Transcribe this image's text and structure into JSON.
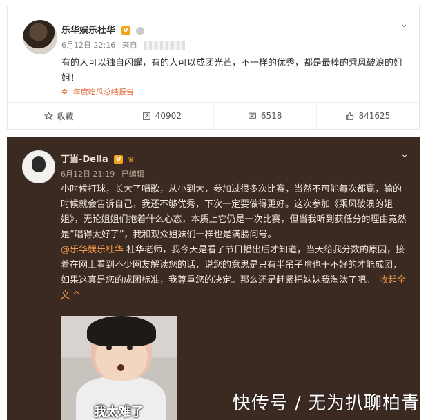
{
  "post1": {
    "author": "乐华娱乐杜华",
    "verify_badge": "V",
    "time": "6月12日 22:16",
    "source": "来自",
    "text": "有的人可以独自闪耀，有的人可以成团光芒，不一样的优秀，都是最棒的乘风破浪的姐姐！",
    "report": "年度吃瓜总结报告",
    "actions": {
      "fav_label": "收藏",
      "repost_count": "40902",
      "comment_count": "6518",
      "like_count": "841625"
    }
  },
  "post2": {
    "author": "丁当-Della",
    "verify_badge": "V",
    "time": "6月12日 21:19",
    "edited": "已编辑",
    "text_a": "小时候打球，长大了唱歌，从小到大，参加过很多次比赛，当然不可能每次都赢，输的时候就会告诉自己，我还不够优秀，下次一定要做得更好。这次参加《乘风破浪的姐姐》，无论姐姐们抱着什么心态，本质上它仍是一次比赛，但当我听到获低分的理由竟然是“唱得太好了”，我和观众姐妹们一样也是满脸问号。",
    "mention": "@乐华娱乐杜华",
    "text_b": " 杜华老师，我今天是看了节目播出后才知道，当天给我分数的原因，接着在网上看到不少网友解读您的话，说您的意思是只有半吊子啥也干不好的才能成团，如果这真是您的成团标准，我尊重您的决定。那么还是赶紧把妹妹我淘汰了吧。",
    "collapse_label": "收起全文 ^",
    "image_caption": "我太难了"
  },
  "watermark": "快传号 / 无为扒聊柏青"
}
